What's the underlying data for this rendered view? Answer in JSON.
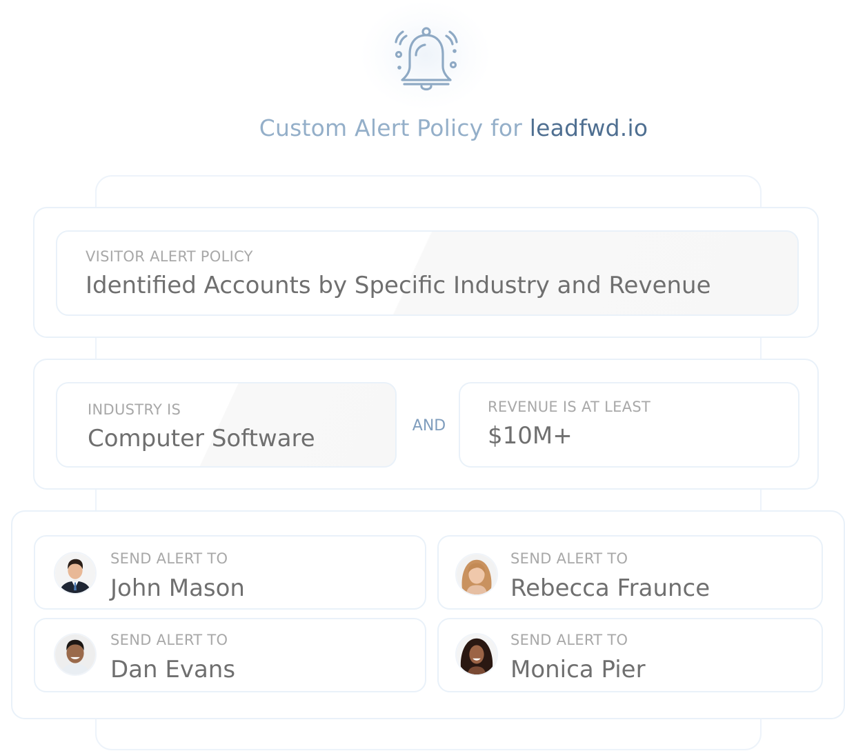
{
  "header": {
    "title_prefix": "Custom Alert Policy for ",
    "title_domain": "leadfwd.io",
    "icon": "bell-alert-icon"
  },
  "policy": {
    "label": "VISITOR ALERT POLICY",
    "value": "Identified Accounts by Specific Industry and Revenue"
  },
  "conditions": {
    "industry_label": "INDUSTRY IS",
    "industry_value": "Computer Software",
    "connector": "AND",
    "revenue_label": "REVENUE IS AT LEAST",
    "revenue_value": "$10M+"
  },
  "recipients": [
    {
      "label": "SEND ALERT TO",
      "name": "John Mason",
      "avatar": "avatar-man-suit"
    },
    {
      "label": "SEND ALERT TO",
      "name": "Rebecca Fraunce",
      "avatar": "avatar-woman-blonde"
    },
    {
      "label": "SEND ALERT TO",
      "name": "Dan Evans",
      "avatar": "avatar-man-smiling"
    },
    {
      "label": "SEND ALERT TO",
      "name": "Monica Pier",
      "avatar": "avatar-woman-dark-hair"
    }
  ],
  "colors": {
    "title_light": "#94afc9",
    "title_dark": "#4f6f91",
    "card_border": "#e9f1f9",
    "label_gray": "#a8a8a8",
    "value_gray": "#6f6f6f",
    "connector_blue": "#7f9dbd"
  }
}
